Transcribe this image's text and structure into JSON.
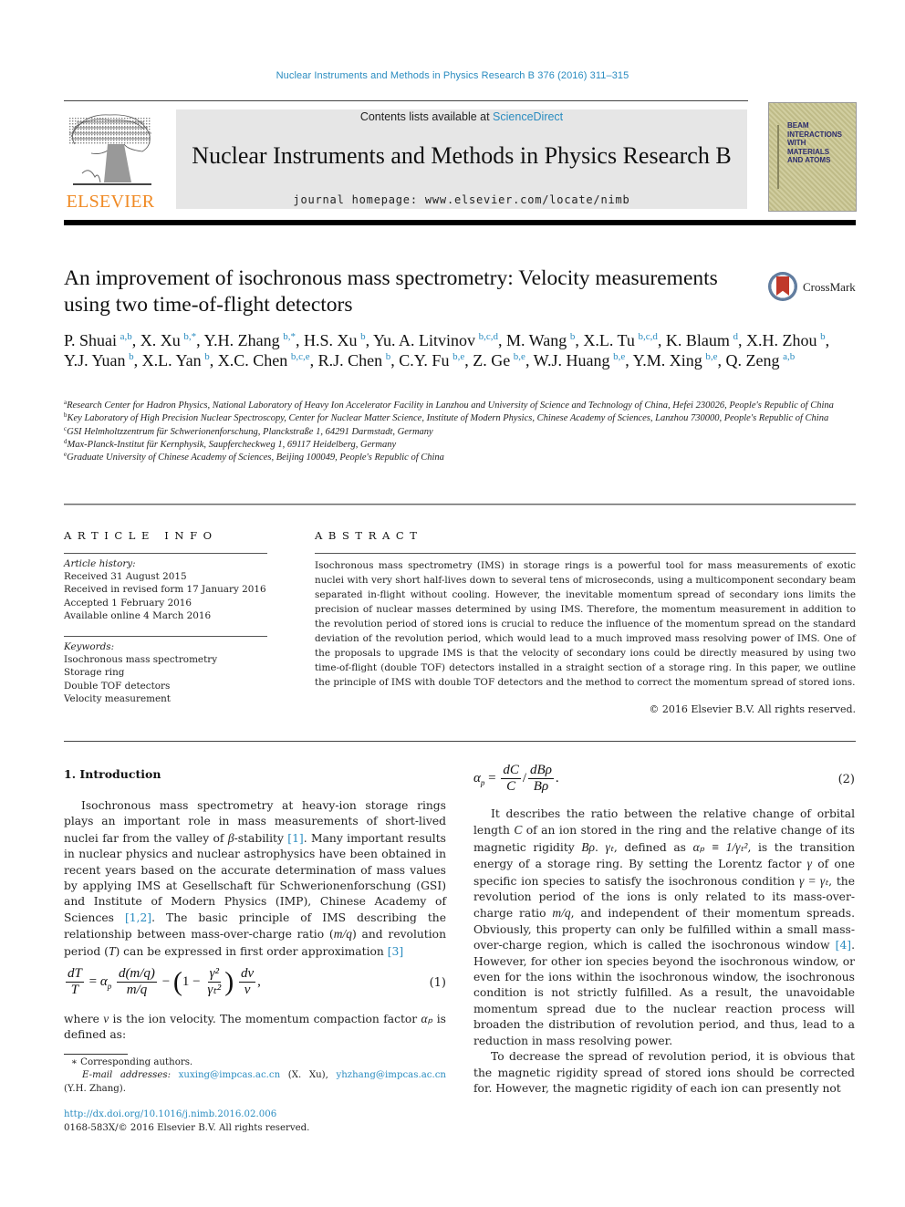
{
  "running_head": "Nuclear Instruments and Methods in Physics Research B 376 (2016) 311–315",
  "publisher": {
    "name": "ELSEVIER",
    "logo_icon": "elsevier-tree-icon",
    "color": "#f08a24"
  },
  "masthead": {
    "contents_prefix": "Contents lists available at ",
    "contents_link": "ScienceDirect",
    "journal_title": "Nuclear Instruments and Methods in Physics Research B",
    "homepage": "journal homepage: www.elsevier.com/locate/nimb"
  },
  "cover": {
    "title_lines": [
      "BEAM",
      "INTERACTIONS",
      "WITH",
      "MATERIALS",
      "AND ATOMS"
    ]
  },
  "crossmark": {
    "label": "CrossMark",
    "icon": "crossmark-icon"
  },
  "article": {
    "title": "An improvement of isochronous mass spectrometry: Velocity measurements using two time-of-flight detectors",
    "authors": [
      {
        "name": "P. Shuai",
        "aff": "a,b"
      },
      {
        "name": "X. Xu",
        "aff": "b,*"
      },
      {
        "name": "Y.H. Zhang",
        "aff": "b,*"
      },
      {
        "name": "H.S. Xu",
        "aff": "b"
      },
      {
        "name": "Yu. A. Litvinov",
        "aff": "b,c,d"
      },
      {
        "name": "M. Wang",
        "aff": "b"
      },
      {
        "name": "X.L. Tu",
        "aff": "b,c,d"
      },
      {
        "name": "K. Blaum",
        "aff": "d"
      },
      {
        "name": "X.H. Zhou",
        "aff": "b"
      },
      {
        "name": "Y.J. Yuan",
        "aff": "b"
      },
      {
        "name": "X.L. Yan",
        "aff": "b"
      },
      {
        "name": "X.C. Chen",
        "aff": "b,c,e"
      },
      {
        "name": "R.J. Chen",
        "aff": "b"
      },
      {
        "name": "C.Y. Fu",
        "aff": "b,e"
      },
      {
        "name": "Z. Ge",
        "aff": "b,e"
      },
      {
        "name": "W.J. Huang",
        "aff": "b,e"
      },
      {
        "name": "Y.M. Xing",
        "aff": "b,e"
      },
      {
        "name": "Q. Zeng",
        "aff": "a,b"
      }
    ],
    "affiliations": [
      {
        "key": "a",
        "text": "Research Center for Hadron Physics, National Laboratory of Heavy Ion Accelerator Facility in Lanzhou and University of Science and Technology of China, Hefei 230026, People's Republic of China"
      },
      {
        "key": "b",
        "text": "Key Laboratory of High Precision Nuclear Spectroscopy, Center for Nuclear Matter Science, Institute of Modern Physics, Chinese Academy of Sciences, Lanzhou 730000, People's Republic of China"
      },
      {
        "key": "c",
        "text": "GSI Helmholtzzentrum für Schwerionenforschung, Planckstraße 1, 64291 Darmstadt, Germany"
      },
      {
        "key": "d",
        "text": "Max-Planck-Institut für Kernphysik, Saupfercheckweg 1, 69117 Heidelberg, Germany"
      },
      {
        "key": "e",
        "text": "Graduate University of Chinese Academy of Sciences, Beijing 100049, People's Republic of China"
      }
    ]
  },
  "article_info": {
    "heading": "ARTICLE INFO",
    "history_label": "Article history:",
    "history": [
      "Received 31 August 2015",
      "Received in revised form 17 January 2016",
      "Accepted 1 February 2016",
      "Available online 4 March 2016"
    ],
    "keywords_label": "Keywords:",
    "keywords": [
      "Isochronous mass spectrometry",
      "Storage ring",
      "Double TOF detectors",
      "Velocity measurement"
    ]
  },
  "abstract": {
    "heading": "ABSTRACT",
    "text": "Isochronous mass spectrometry (IMS) in storage rings is a powerful tool for mass measurements of exotic nuclei with very short half-lives down to several tens of microseconds, using a multicomponent secondary beam separated in-flight without cooling. However, the inevitable momentum spread of secondary ions limits the precision of nuclear masses determined by using IMS. Therefore, the momentum measurement in addition to the revolution period of stored ions is crucial to reduce the influence of the momentum spread on the standard deviation of the revolution period, which would lead to a much improved mass resolving power of IMS. One of the proposals to upgrade IMS is that the velocity of secondary ions could be directly measured by using two time-of-flight (double TOF) detectors installed in a straight section of a storage ring. In this paper, we outline the principle of IMS with double TOF detectors and the method to correct the momentum spread of stored ions.",
    "copyright": "© 2016 Elsevier B.V. All rights reserved."
  },
  "body": {
    "section_heading": "1. Introduction",
    "p1": {
      "a": "Isochronous mass spectrometry at heavy-ion storage rings plays an important role in mass measurements of short-lived nuclei far from the valley of ",
      "beta": "β",
      "b": "-stability ",
      "ref1": "[1]",
      "c": ". Many important results in nuclear physics and nuclear astrophysics have been obtained in recent years based on the accurate determination of mass values by applying IMS at Gesellschaft für Schwerionenforschung (GSI) and Institute of Modern Physics (IMP), Chinese Academy of Sciences ",
      "ref2": "[1,2]",
      "d": ". The basic principle of IMS describing the relationship between mass-over-charge ratio (",
      "mq": "m/q",
      "e": ") and revolution period (",
      "T": "T",
      "f": ") can be expressed in first order approximation ",
      "ref3": "[3]"
    },
    "eq1": {
      "lhs_num": "dT",
      "lhs_den": "T",
      "eq": "=",
      "alpha": "α",
      "alpha_sub": "p",
      "f1_num": "d(m/q)",
      "f1_den": "m/q",
      "minus": "−",
      "one": "1",
      "minus2": "−",
      "g_num": "γ²",
      "g_den": "γₜ²",
      "f2_num": "dv",
      "f2_den": "v",
      "comma": ",",
      "number": "(1)"
    },
    "p2": {
      "a": "where ",
      "v": "v",
      "b": " is the ion velocity. The momentum compaction factor ",
      "alpha": "αₚ",
      "c": " is defined as:"
    },
    "eq2": {
      "alpha": "α",
      "alpha_sub": "p",
      "eq": "=",
      "f1_num": "dC",
      "f1_den": "C",
      "slash": "/",
      "f2_num": "dBρ",
      "f2_den": "Bρ",
      "dot": ".",
      "number": "(2)"
    },
    "p3": {
      "a": "It describes the ratio between the relative change of orbital length ",
      "C": "C",
      "b": " of an ion stored in the ring and the relative change of its magnetic rigidity ",
      "Brho": "Bρ",
      "c": ". ",
      "gt": "γₜ",
      "d": ", defined as ",
      "def": "αₚ ≡ 1/γₜ²",
      "e": ", is the transition energy of a storage ring. By setting the Lorentz factor ",
      "g": "γ",
      "f": " of one specific ion species to satisfy the isochronous condition ",
      "cond": "γ = γₜ",
      "g2": ", the revolution period of the ions is only related to its mass-over-charge ratio ",
      "mq": "m/q",
      "h": ", and independent of their momentum spreads. Obviously, this property can only be fulfilled within a small mass-over-charge region, which is called the isochronous window ",
      "ref4": "[4]",
      "i": ". However, for other ion species beyond the isochronous window, or even for the ions within the isochronous window, the isochronous condition is not strictly fulfilled. As a result, the unavoidable momentum spread due to the nuclear reaction process will broaden the distribution of revolution period, and thus, lead to a reduction in mass resolving power."
    },
    "p4": "To decrease the spread of revolution period, it is obvious that the magnetic rigidity spread of stored ions should be corrected for. However, the magnetic rigidity of each ion can presently not"
  },
  "footnotes": {
    "corresponding": "∗  Corresponding authors.",
    "email_label": "E-mail addresses:",
    "email1": "xuxing@impcas.ac.cn",
    "email1_who": " (X. Xu), ",
    "email2": "yhzhang@impcas.ac.cn",
    "email2_who": "(Y.H. Zhang).",
    "doi": "http://dx.doi.org/10.1016/j.nimb.2016.02.006",
    "issn": "0168-583X/© 2016 Elsevier B.V. All rights reserved."
  }
}
